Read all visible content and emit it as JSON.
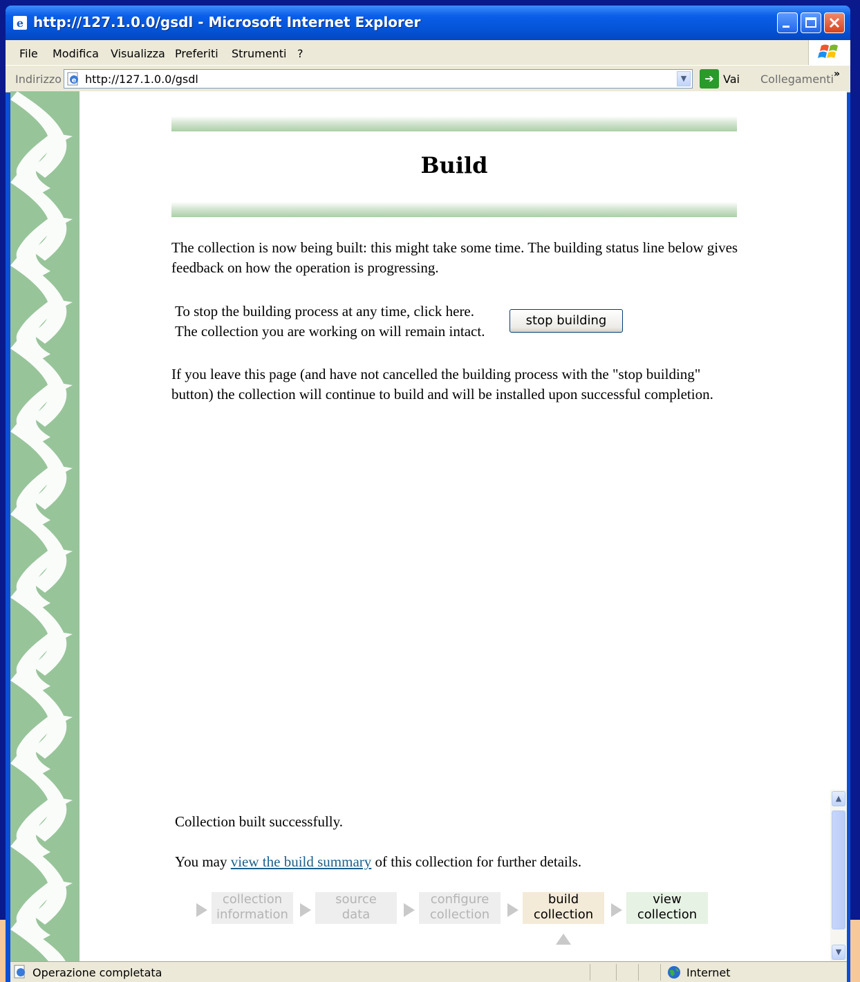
{
  "window": {
    "title": "http://127.1.0.0/gsdl - Microsoft Internet Explorer"
  },
  "menu": {
    "items": [
      "File",
      "Modifica",
      "Visualizza",
      "Preferiti",
      "Strumenti",
      "?"
    ]
  },
  "address_bar": {
    "label": "Indirizzo",
    "url": "http://127.1.0.0/gsdl",
    "go_label": "Vai",
    "links_label": "Collegamenti"
  },
  "page": {
    "title": "Build",
    "intro": "The collection is now being built: this might take some time. The building status line below gives feedback on how the operation is progressing.",
    "stop_line1": "To stop the building process at any time, click here.",
    "stop_line2": "The collection you are working on will remain intact.",
    "stop_button": "stop building",
    "leave_note": "If you leave this page (and have not cancelled the building process with the \"stop building\" button) the collection will continue to build and will be installed upon successful completion.",
    "status_done": "Collection built successfully.",
    "summary_prefix": "You may",
    "summary_link": "view the build summary",
    "summary_suffix": "of this collection for further details."
  },
  "steps": [
    {
      "line1": "collection",
      "line2": "information",
      "state": "done"
    },
    {
      "line1": "source",
      "line2": "data",
      "state": "done"
    },
    {
      "line1": "configure",
      "line2": "collection",
      "state": "done"
    },
    {
      "line1": "build",
      "line2": "collection",
      "state": "current"
    },
    {
      "line1": "view",
      "line2": "collection",
      "state": "next"
    }
  ],
  "status_bar": {
    "text": "Operazione completata",
    "zone": "Internet"
  }
}
